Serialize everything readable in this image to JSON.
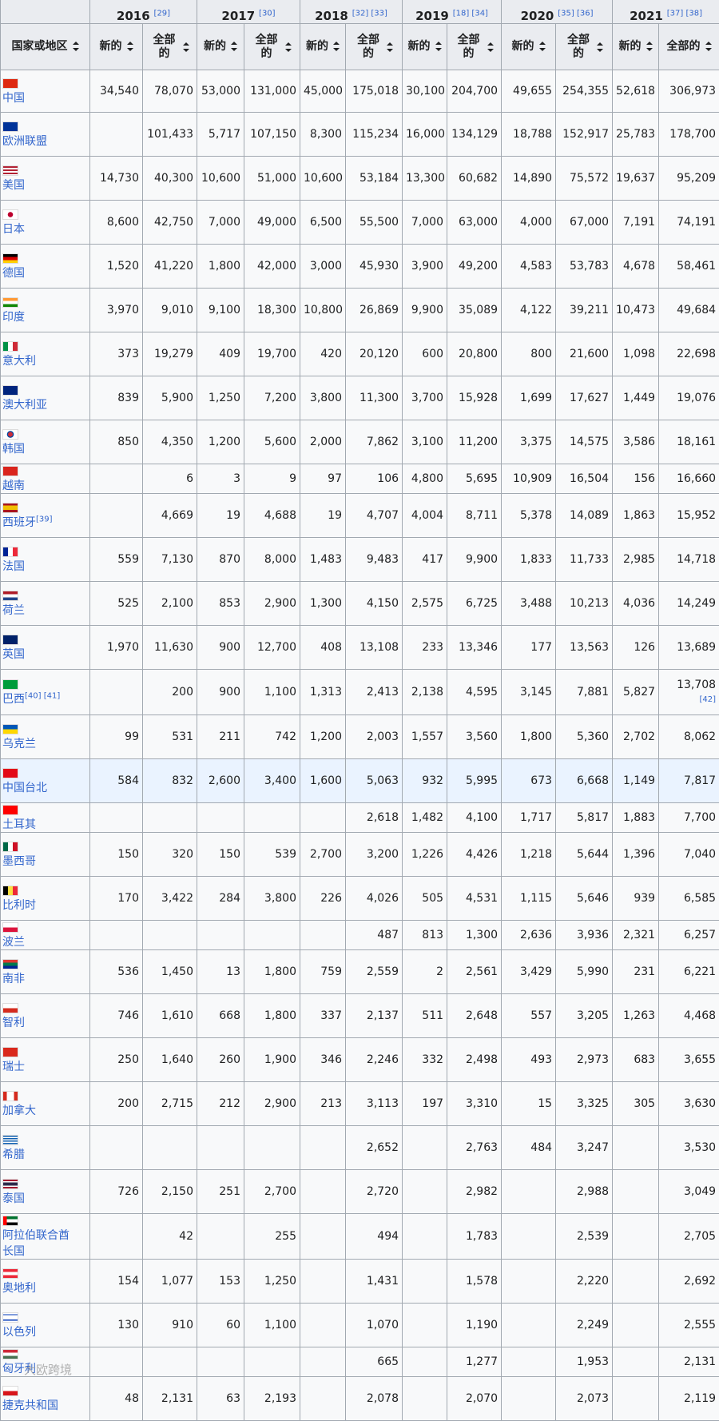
{
  "header": {
    "country_col": "国家或地区",
    "years": [
      {
        "year": "2016",
        "refs": "[29]"
      },
      {
        "year": "2017",
        "refs": "[30]"
      },
      {
        "year": "2018",
        "refs": "[32] [33]"
      },
      {
        "year": "2019",
        "refs": "[18] [34]"
      },
      {
        "year": "2020",
        "refs": "[35] [36]"
      },
      {
        "year": "2021",
        "refs": "[37] [38]"
      }
    ],
    "new_label": "新的",
    "total_label": "全部的",
    "total_label_last": "全部的"
  },
  "rows": [
    {
      "name": "中国",
      "flag": "china",
      "vals": [
        "34,540",
        "78,070",
        "53,000",
        "131,000",
        "45,000",
        "175,018",
        "30,100",
        "204,700",
        "49,655",
        "254,355",
        "52,618",
        "306,973"
      ]
    },
    {
      "name": "欧洲联盟",
      "flag": "eu",
      "vals": [
        "",
        "101,433",
        "5,717",
        "107,150",
        "8,300",
        "115,234",
        "16,000",
        "134,129",
        "18,788",
        "152,917",
        "25,783",
        "178,700"
      ]
    },
    {
      "name": "美国",
      "flag": "usa",
      "vals": [
        "14,730",
        "40,300",
        "10,600",
        "51,000",
        "10,600",
        "53,184",
        "13,300",
        "60,682",
        "14,890",
        "75,572",
        "19,637",
        "95,209"
      ]
    },
    {
      "name": "日本",
      "flag": "japan",
      "vals": [
        "8,600",
        "42,750",
        "7,000",
        "49,000",
        "6,500",
        "55,500",
        "7,000",
        "63,000",
        "4,000",
        "67,000",
        "7,191",
        "74,191"
      ]
    },
    {
      "name": "德国",
      "flag": "germany",
      "vals": [
        "1,520",
        "41,220",
        "1,800",
        "42,000",
        "3,000",
        "45,930",
        "3,900",
        "49,200",
        "4,583",
        "53,783",
        "4,678",
        "58,461"
      ]
    },
    {
      "name": "印度",
      "flag": "india",
      "vals": [
        "3,970",
        "9,010",
        "9,100",
        "18,300",
        "10,800",
        "26,869",
        "9,900",
        "35,089",
        "4,122",
        "39,211",
        "10,473",
        "49,684"
      ]
    },
    {
      "name": "意大利",
      "flag": "italy",
      "vals": [
        "373",
        "19,279",
        "409",
        "19,700",
        "420",
        "20,120",
        "600",
        "20,800",
        "800",
        "21,600",
        "1,098",
        "22,698"
      ]
    },
    {
      "name": "澳大利亚",
      "flag": "australia",
      "vals": [
        "839",
        "5,900",
        "1,250",
        "7,200",
        "3,800",
        "11,300",
        "3,700",
        "15,928",
        "1,699",
        "17,627",
        "1,449",
        "19,076"
      ]
    },
    {
      "name": "韩国",
      "flag": "korea",
      "vals": [
        "850",
        "4,350",
        "1,200",
        "5,600",
        "2,000",
        "7,862",
        "3,100",
        "11,200",
        "3,375",
        "14,575",
        "3,586",
        "18,161"
      ]
    },
    {
      "name": "越南",
      "flag": "vietnam",
      "vals": [
        "",
        "6",
        "3",
        "9",
        "97",
        "106",
        "4,800",
        "5,695",
        "10,909",
        "16,504",
        "156",
        "16,660"
      ]
    },
    {
      "name": "西班牙",
      "ref": "[39]",
      "flag": "spain",
      "vals": [
        "",
        "4,669",
        "19",
        "4,688",
        "19",
        "4,707",
        "4,004",
        "8,711",
        "5,378",
        "14,089",
        "1,863",
        "15,952"
      ]
    },
    {
      "name": "法国",
      "flag": "france",
      "vals": [
        "559",
        "7,130",
        "870",
        "8,000",
        "1,483",
        "9,483",
        "417",
        "9,900",
        "1,833",
        "11,733",
        "2,985",
        "14,718"
      ]
    },
    {
      "name": "荷兰",
      "flag": "netherlands",
      "vals": [
        "525",
        "2,100",
        "853",
        "2,900",
        "1,300",
        "4,150",
        "2,575",
        "6,725",
        "3,488",
        "10,213",
        "4,036",
        "14,249"
      ]
    },
    {
      "name": "英国",
      "flag": "uk",
      "vals": [
        "1,970",
        "11,630",
        "900",
        "12,700",
        "408",
        "13,108",
        "233",
        "13,346",
        "177",
        "13,563",
        "126",
        "13,689"
      ]
    },
    {
      "name": "巴西",
      "ref": "[40] [41]",
      "flag": "brazil",
      "vals": [
        "",
        "200",
        "900",
        "1,100",
        "1,313",
        "2,413",
        "2,138",
        "4,595",
        "3,145",
        "7,881",
        "5,827",
        "13,708"
      ],
      "last_ref": "[42]"
    },
    {
      "name": "乌克兰",
      "flag": "ukraine",
      "vals": [
        "99",
        "531",
        "211",
        "742",
        "1,200",
        "2,003",
        "1,557",
        "3,560",
        "1,800",
        "5,360",
        "2,702",
        "8,062"
      ]
    },
    {
      "name": "中国台北",
      "flag": "turkey",
      "highlight": true,
      "vals": [
        "584",
        "832",
        "2,600",
        "3,400",
        "1,600",
        "5,063",
        "932",
        "5,995",
        "673",
        "6,668",
        "1,149",
        "7,817"
      ]
    },
    {
      "name": "土耳其",
      "flag": "taiwan",
      "vals": [
        "",
        "",
        "",
        "",
        "",
        "2,618",
        "1,482",
        "4,100",
        "1,717",
        "5,817",
        "1,883",
        "7,700"
      ]
    },
    {
      "name": "墨西哥",
      "flag": "mexico",
      "vals": [
        "150",
        "320",
        "150",
        "539",
        "2,700",
        "3,200",
        "1,226",
        "4,426",
        "1,218",
        "5,644",
        "1,396",
        "7,040"
      ]
    },
    {
      "name": "比利时",
      "flag": "belgium",
      "vals": [
        "170",
        "3,422",
        "284",
        "3,800",
        "226",
        "4,026",
        "505",
        "4,531",
        "1,115",
        "5,646",
        "939",
        "6,585"
      ]
    },
    {
      "name": "波兰",
      "flag": "poland",
      "vals": [
        "",
        "",
        "",
        "",
        "",
        "487",
        "813",
        "1,300",
        "2,636",
        "3,936",
        "2,321",
        "6,257"
      ]
    },
    {
      "name": "南非",
      "flag": "southafrica",
      "vals": [
        "536",
        "1,450",
        "13",
        "1,800",
        "759",
        "2,559",
        "2",
        "2,561",
        "3,429",
        "5,990",
        "231",
        "6,221"
      ]
    },
    {
      "name": "智利",
      "flag": "chile",
      "vals": [
        "746",
        "1,610",
        "668",
        "1,800",
        "337",
        "2,137",
        "511",
        "2,648",
        "557",
        "3,205",
        "1,263",
        "4,468"
      ]
    },
    {
      "name": "瑞士",
      "flag": "switzerland",
      "vals": [
        "250",
        "1,640",
        "260",
        "1,900",
        "346",
        "2,246",
        "332",
        "2,498",
        "493",
        "2,973",
        "683",
        "3,655"
      ]
    },
    {
      "name": "加拿大",
      "flag": "canada",
      "vals": [
        "200",
        "2,715",
        "212",
        "2,900",
        "213",
        "3,113",
        "197",
        "3,310",
        "15",
        "3,325",
        "305",
        "3,630"
      ]
    },
    {
      "name": "希腊",
      "flag": "greece",
      "vals": [
        "",
        "",
        "",
        "",
        "",
        "2,652",
        "",
        "2,763",
        "484",
        "3,247",
        "",
        "3,530"
      ]
    },
    {
      "name": "泰国",
      "flag": "thailand",
      "vals": [
        "726",
        "2,150",
        "251",
        "2,700",
        "",
        "2,720",
        "",
        "2,982",
        "",
        "2,988",
        "",
        "3,049"
      ]
    },
    {
      "name": "阿拉伯联合酋长国",
      "flag": "uae",
      "vals": [
        "",
        "42",
        "",
        "255",
        "",
        "494",
        "",
        "1,783",
        "",
        "2,539",
        "",
        "2,705"
      ]
    },
    {
      "name": "奥地利",
      "flag": "austria",
      "vals": [
        "154",
        "1,077",
        "153",
        "1,250",
        "",
        "1,431",
        "",
        "1,578",
        "",
        "2,220",
        "",
        "2,692"
      ]
    },
    {
      "name": "以色列",
      "flag": "israel",
      "vals": [
        "130",
        "910",
        "60",
        "1,100",
        "",
        "1,070",
        "",
        "1,190",
        "",
        "2,249",
        "",
        "2,555"
      ]
    },
    {
      "name": "匈牙利",
      "flag": "hungary",
      "vals": [
        "",
        "",
        "",
        "",
        "",
        "665",
        "",
        "1,277",
        "",
        "1,953",
        "",
        "2,131"
      ]
    },
    {
      "name": "捷克共和国",
      "flag": "czech",
      "vals": [
        "48",
        "2,131",
        "63",
        "2,193",
        "",
        "2,078",
        "",
        "2,070",
        "",
        "2,073",
        "",
        "2,119"
      ]
    }
  ],
  "watermark": "大欧跨境",
  "colors": {
    "link": "#3366cc",
    "header_bg": "#eaecf0",
    "cell_bg": "#f8f9fa",
    "border": "#a2a9b1",
    "highlight_bg": "#eaf3ff"
  }
}
